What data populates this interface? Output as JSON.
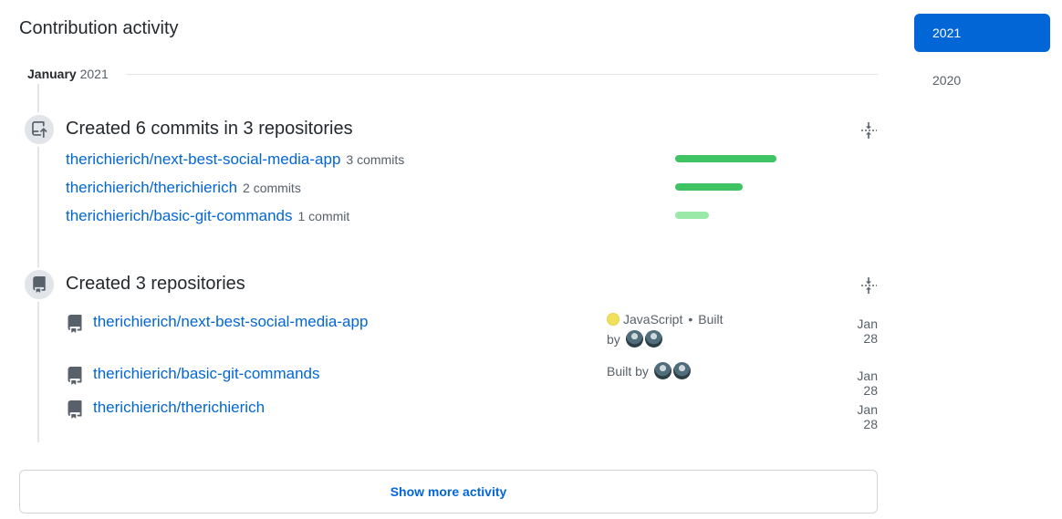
{
  "section_title": "Contribution activity",
  "month": {
    "name": "January",
    "year": "2021"
  },
  "commits_event": {
    "title": "Created 6 commits in 3 repositories",
    "icon": "repo-push-icon",
    "rows": [
      {
        "repo": "therichierich/next-best-social-media-app",
        "count": "3 commits",
        "share": 1.0,
        "color": "#40c463"
      },
      {
        "repo": "therichierich/therichierich",
        "count": "2 commits",
        "share": 0.6667,
        "color": "#40c463"
      },
      {
        "repo": "therichierich/basic-git-commands",
        "count": "1 commit",
        "share": 0.3333,
        "color": "#9be9a8"
      }
    ]
  },
  "repos_event": {
    "title": "Created 3 repositories",
    "icon": "repo-icon",
    "rows": [
      {
        "repo": "therichierich/next-best-social-media-app",
        "language": "JavaScript",
        "language_color": "#f1e05a",
        "built_by": "Built",
        "by": "by",
        "date": "Jan 28"
      },
      {
        "repo": "therichierich/basic-git-commands",
        "built_by": "Built by",
        "date": "Jan 28"
      },
      {
        "repo": "therichierich/therichierich",
        "date": "Jan 28"
      }
    ]
  },
  "show_more_label": "Show more activity",
  "years": [
    {
      "label": "2021",
      "active": true
    },
    {
      "label": "2020",
      "active": false
    }
  ],
  "colors": {
    "link": "#0366d6",
    "accent": "#0366d6",
    "bar_strong": "#40c463",
    "bar_light": "#9be9a8"
  }
}
